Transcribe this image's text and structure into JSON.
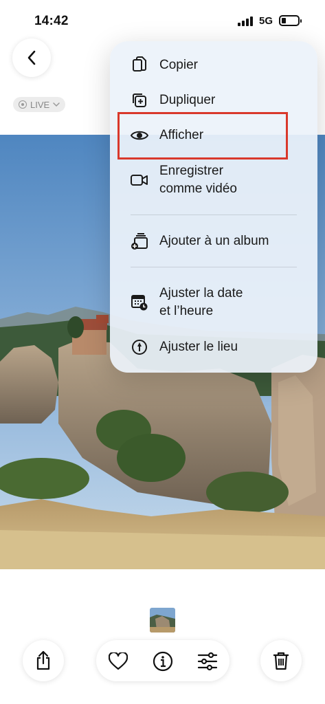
{
  "status_bar": {
    "time": "14:42",
    "network": "5G"
  },
  "badge": {
    "live_label": "LIVE"
  },
  "menu": {
    "items": [
      {
        "label": "Copier",
        "icon": "copy-icon"
      },
      {
        "label": "Dupliquer",
        "icon": "duplicate-icon"
      },
      {
        "label": "Afficher",
        "icon": "eye-icon"
      },
      {
        "label_line1": "Enregistrer",
        "label_line2": "comme vidéo",
        "icon": "video-icon"
      },
      {
        "label": "Ajouter à un album",
        "icon": "add-album-icon"
      },
      {
        "label_line1": "Ajuster la date",
        "label_line2": "et l’heure",
        "icon": "calendar-clock-icon"
      },
      {
        "label": "Ajuster le lieu",
        "icon": "location-icon"
      }
    ]
  },
  "colors": {
    "highlight": "#d9382b",
    "menu_bg": "#ecf2fa"
  },
  "toolbar": {
    "icons": [
      "share-icon",
      "heart-icon",
      "info-icon",
      "adjust-icon",
      "trash-icon"
    ]
  }
}
